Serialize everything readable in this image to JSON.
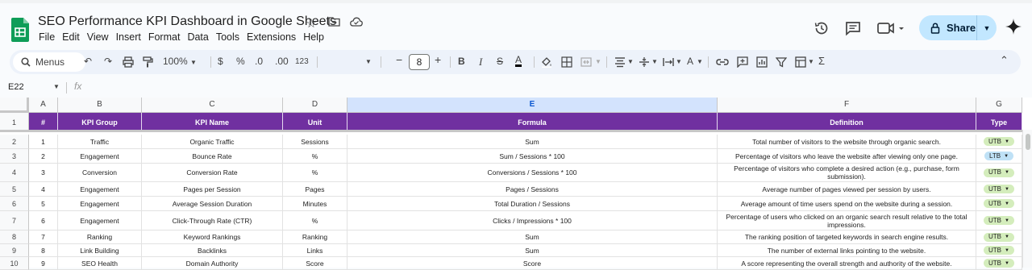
{
  "doc": {
    "title": "SEO Performance KPI Dashboard in Google Sheets",
    "menu": [
      "File",
      "Edit",
      "View",
      "Insert",
      "Format",
      "Data",
      "Tools",
      "Extensions",
      "Help"
    ],
    "share_label": "Share",
    "icons": [
      "star-icon",
      "move-to-folder-icon",
      "cloud-status-icon",
      "history-icon",
      "comment-icon",
      "meet-icon",
      "gemini-icon"
    ]
  },
  "toolbar": {
    "menus_label": "Menus",
    "zoom": "100%",
    "currency": "$",
    "percent": "%",
    "dec_decrease": ".0",
    "dec_increase": ".00",
    "number_format": "123",
    "font_size": "8",
    "minus": "−",
    "plus": "+",
    "bold": "B",
    "italic": "I",
    "strike": "S",
    "text_color": "A",
    "function": "Σ"
  },
  "formula_bar": {
    "name_box": "E22",
    "fx": "fx"
  },
  "columns": [
    "A",
    "B",
    "C",
    "D",
    "E",
    "F",
    "G"
  ],
  "rows": [
    "1",
    "2",
    "3",
    "4",
    "5",
    "6",
    "7",
    "8",
    "9",
    "10"
  ],
  "header": [
    "#",
    "KPI Group",
    "KPI Name",
    "Unit",
    "Formula",
    "Definition",
    "Type"
  ],
  "data": [
    [
      "1",
      "Traffic",
      "Organic Traffic",
      "Sessions",
      "Sum",
      "Total number of visitors to the website through organic search.",
      "UTB"
    ],
    [
      "2",
      "Engagement",
      "Bounce Rate",
      "%",
      "Sum / Sessions * 100",
      "Percentage of visitors who leave the website after viewing only one page.",
      "LTB"
    ],
    [
      "3",
      "Conversion",
      "Conversion Rate",
      "%",
      "Conversions / Sessions * 100",
      "Percentage of visitors who complete a desired action (e.g., purchase, form submission).",
      "UTB"
    ],
    [
      "4",
      "Engagement",
      "Pages per Session",
      "Pages",
      "Pages / Sessions",
      "Average number of pages viewed per session by users.",
      "UTB"
    ],
    [
      "5",
      "Engagement",
      "Average Session Duration",
      "Minutes",
      "Total Duration / Sessions",
      "Average amount of time users spend on the website during a session.",
      "UTB"
    ],
    [
      "6",
      "Engagement",
      "Click-Through Rate (CTR)",
      "%",
      "Clicks / Impressions * 100",
      "Percentage of users who clicked on an organic search result relative to the total impressions.",
      "UTB"
    ],
    [
      "7",
      "Ranking",
      "Keyword Rankings",
      "Ranking",
      "Sum",
      "The ranking position of targeted keywords in search engine results.",
      "UTB"
    ],
    [
      "8",
      "Link Building",
      "Backlinks",
      "Links",
      "Sum",
      "The number of external links pointing to the website.",
      "UTB"
    ],
    [
      "9",
      "SEO Health",
      "Domain Authority",
      "Score",
      "Score",
      "A score representing the overall strength and authority of the website.",
      "UTB"
    ]
  ],
  "colors": {
    "header_purple": "#7030a0",
    "utb_chip": "#d4edbc",
    "ltb_chip": "#bfe1f6",
    "share_bg": "#c2e7ff",
    "selected_col": "#d3e3fd"
  }
}
